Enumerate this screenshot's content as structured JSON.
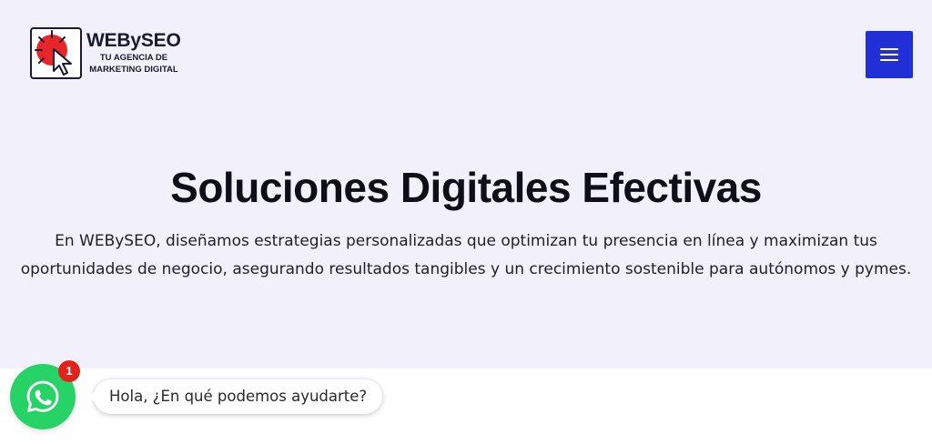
{
  "header": {
    "logo": {
      "name": "WEBySEO",
      "tagline_line1": "TU AGENCIA DE",
      "tagline_line2": "MARKETING DIGITAL",
      "icon": "cursor-click-icon",
      "accent_color": "#e8262a"
    },
    "menu_button": {
      "icon": "hamburger-menu-icon",
      "color": "#2030d6"
    }
  },
  "hero": {
    "title": "Soluciones Digitales Efectivas",
    "description": "En WEBySEO, diseñamos estrategias personalizadas que optimizan tu presencia en línea y maximizan tus oportunidades de negocio, asegurando resultados tangibles y un crecimiento sostenible para autónomos y pymes.",
    "background": "#f1f0fb"
  },
  "chat_widget": {
    "icon": "whatsapp-icon",
    "color": "#27d366",
    "badge_count": "1",
    "message": "Hola, ¿En qué podemos ayudarte?"
  }
}
